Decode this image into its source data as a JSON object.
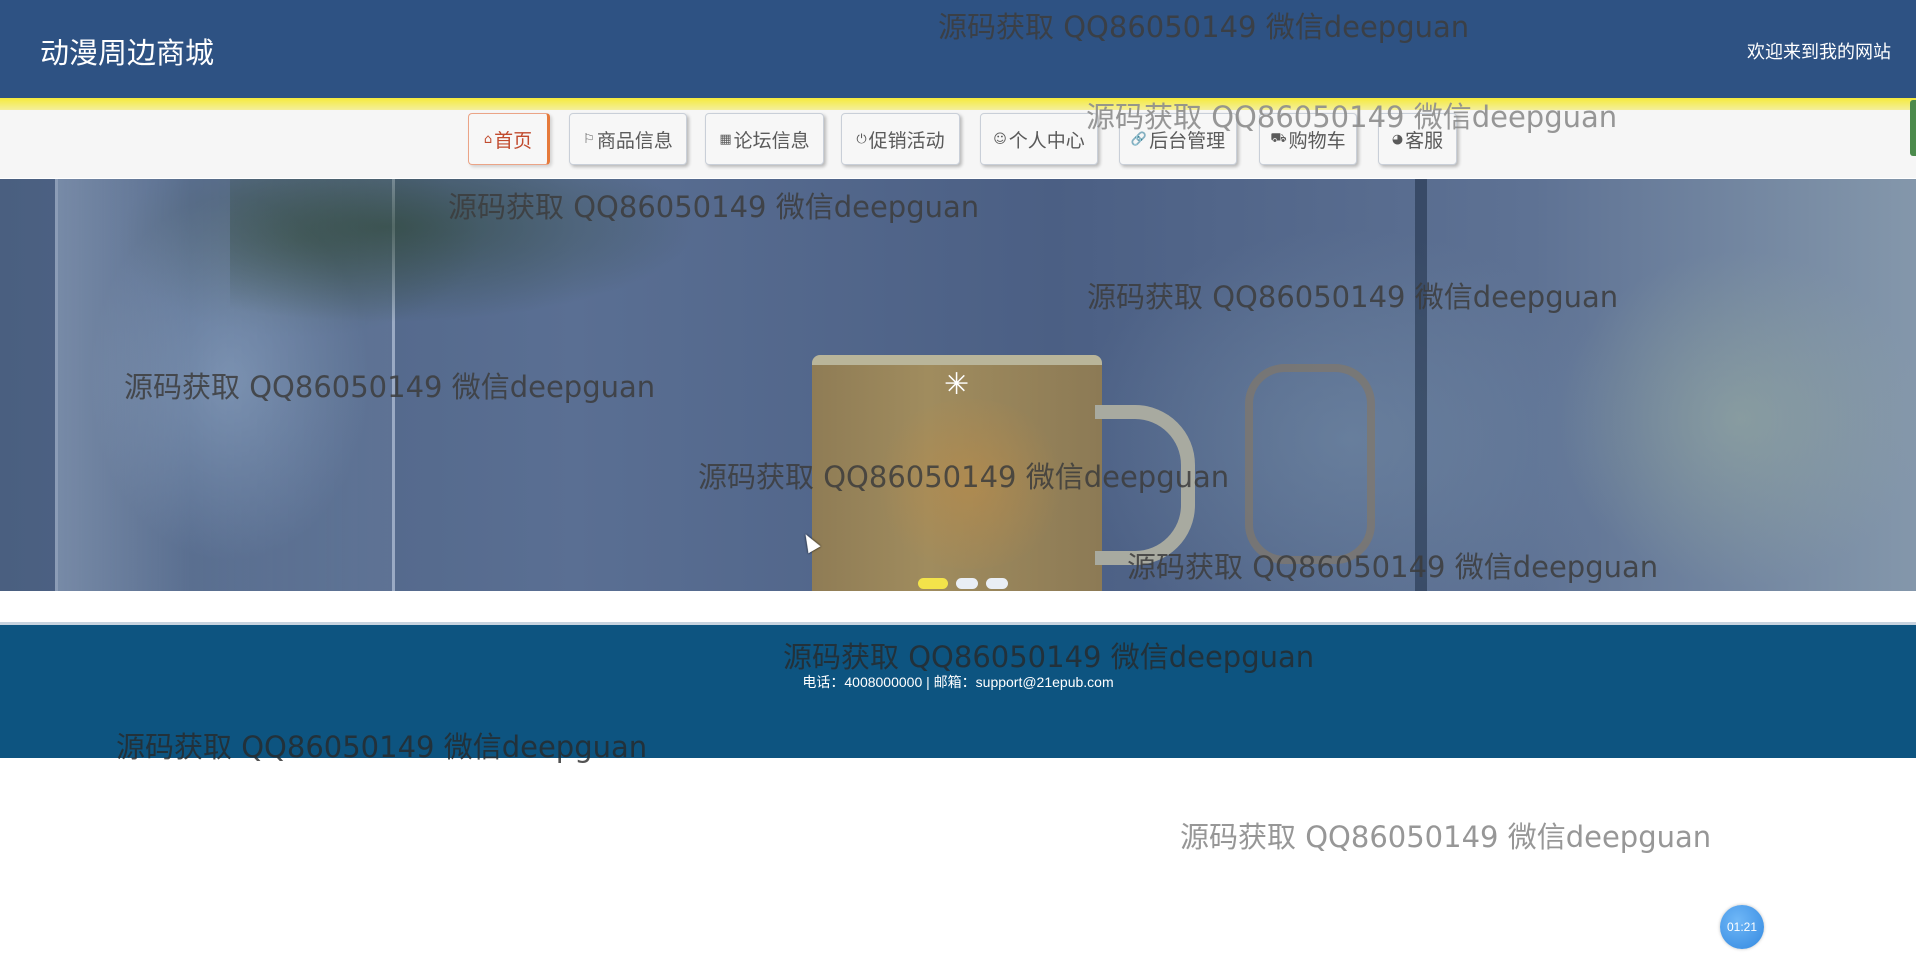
{
  "header": {
    "site_title": "动漫周边商城",
    "welcome_text": "欢迎来到我的网站"
  },
  "nav": {
    "items": [
      {
        "label": "首页",
        "icon": "home-icon",
        "glyph": "⌂"
      },
      {
        "label": "商品信息",
        "icon": "flag-icon",
        "glyph": "⚐"
      },
      {
        "label": "论坛信息",
        "icon": "apps-icon",
        "glyph": "▦"
      },
      {
        "label": "促销活动",
        "icon": "power-icon",
        "glyph": "⏻"
      },
      {
        "label": "个人中心",
        "icon": "user-icon",
        "glyph": "☺"
      },
      {
        "label": "后台管理",
        "icon": "link-icon",
        "glyph": "🔗"
      },
      {
        "label": "购物车",
        "icon": "cart-icon",
        "glyph": "⛟"
      },
      {
        "label": "客服",
        "icon": "chat-icon",
        "glyph": "◕"
      }
    ],
    "active_index": 0
  },
  "banner": {
    "slide_count": 3,
    "active_slide": 1,
    "loading_glyph": "✳"
  },
  "footer": {
    "contact": "电话：4008000000 | 邮箱：support@21epub.com"
  },
  "timer": {
    "text": "01:21"
  },
  "watermark": {
    "text": "源码获取 QQ86050149 微信deepguan"
  },
  "colors": {
    "header_bg": "#2e5283",
    "accent_yellow": "#f5ea3c",
    "footer_bg": "#0d5480",
    "active_nav_text": "#c14b2e",
    "timer_bg": "#3489e0"
  }
}
